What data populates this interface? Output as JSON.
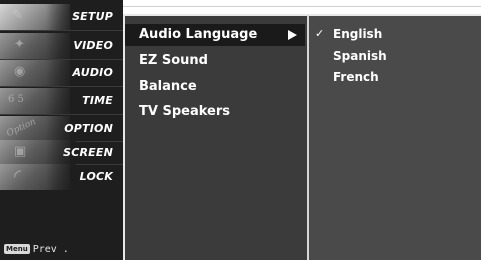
{
  "sidebar": {
    "items": [
      {
        "label": "SETUP",
        "glyph": "✎",
        "selected": true
      },
      {
        "label": "VIDEO",
        "glyph": "✦",
        "selected": false
      },
      {
        "label": "AUDIO",
        "glyph": "◉",
        "selected": false
      },
      {
        "label": "TIME",
        "glyph": "6  5",
        "selected": false
      },
      {
        "label": "OPTION",
        "glyph": "Option",
        "selected": false
      },
      {
        "label": "SCREEN",
        "glyph": "▣",
        "selected": false
      },
      {
        "label": "LOCK",
        "glyph": "◜",
        "selected": false
      }
    ],
    "footer": {
      "menu_key": "Menu",
      "prev_label": "Prev ."
    }
  },
  "main_menu": {
    "items": [
      {
        "label": "Audio Language",
        "selected": true
      },
      {
        "label": "EZ Sound",
        "selected": false
      },
      {
        "label": "Balance",
        "selected": false
      },
      {
        "label": "TV Speakers",
        "selected": false
      }
    ]
  },
  "sub_menu": {
    "check_mark": "✓",
    "items": [
      {
        "label": "English",
        "checked": true
      },
      {
        "label": "Spanish",
        "checked": false
      },
      {
        "label": "French",
        "checked": false
      }
    ]
  },
  "colors": {
    "sidebar_bg": "#1e1e1e",
    "main_panel_bg": "#3b3b3b",
    "sub_panel_bg": "#4a4a4a",
    "selected_row_bg": "#1a1a1a",
    "text": "#ffffff"
  }
}
